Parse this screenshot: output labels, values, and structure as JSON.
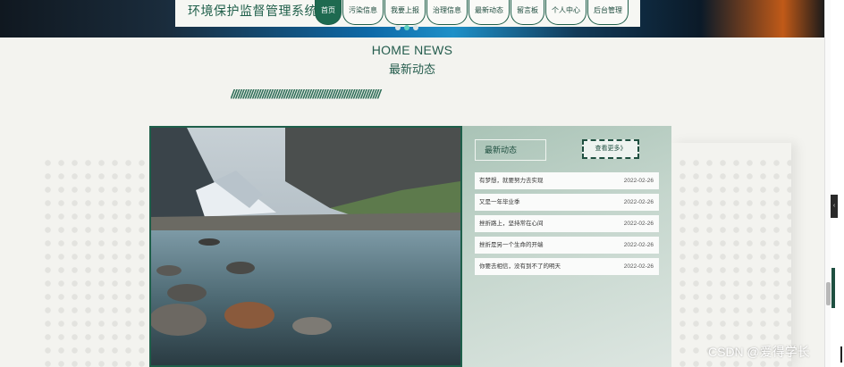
{
  "header": {
    "site_title": "环境保护监督管理系统",
    "nav": [
      {
        "label": "首页",
        "active": true
      },
      {
        "label": "污染信息"
      },
      {
        "label": "我要上报"
      },
      {
        "label": "治理信息"
      },
      {
        "label": "最新动态"
      },
      {
        "label": "留言板"
      },
      {
        "label": "个人中心"
      },
      {
        "label": "后台管理"
      }
    ],
    "carousel_dots": 3,
    "carousel_active": 2
  },
  "section": {
    "title_en": "HOME NEWS",
    "title_cn": "最新动态",
    "divider": "//////////////////////////////////////////////////////////////"
  },
  "news": {
    "heading": "最新动态",
    "more_label": "查看更多》",
    "items": [
      {
        "title": "有梦想，就要努力去实现",
        "date": "2022-02-26"
      },
      {
        "title": "又是一年毕业季",
        "date": "2022-02-26"
      },
      {
        "title": "挫折路上，坚持常在心间",
        "date": "2022-02-26"
      },
      {
        "title": "挫折是另一个生命的开端",
        "date": "2022-02-26"
      },
      {
        "title": "你要去相信，没有到不了的明天",
        "date": "2022-02-26"
      }
    ]
  },
  "side": {
    "tab_glyph": "‹"
  },
  "watermark": "CSDN @爱得学长",
  "colors": {
    "brand": "#1e6a50",
    "panel": "#b5cdc0",
    "background": "#f3f3ef"
  }
}
